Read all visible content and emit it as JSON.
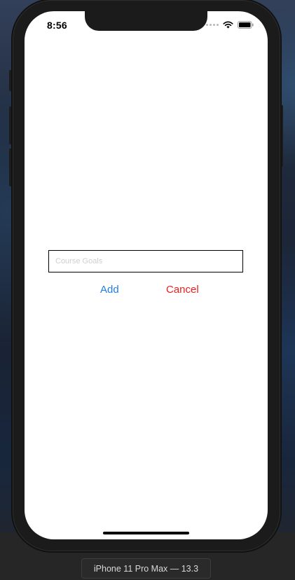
{
  "status_bar": {
    "time": "8:56"
  },
  "form": {
    "goal_input_placeholder": "Course Goals",
    "goal_input_value": "",
    "add_label": "Add",
    "cancel_label": "Cancel"
  },
  "simulator": {
    "device_label": "iPhone 11 Pro Max — 13.3"
  },
  "colors": {
    "add_button": "#1f7ee0",
    "cancel_button": "#e8201f"
  },
  "icons": [
    "signal-icon",
    "wifi-icon",
    "battery-icon"
  ]
}
